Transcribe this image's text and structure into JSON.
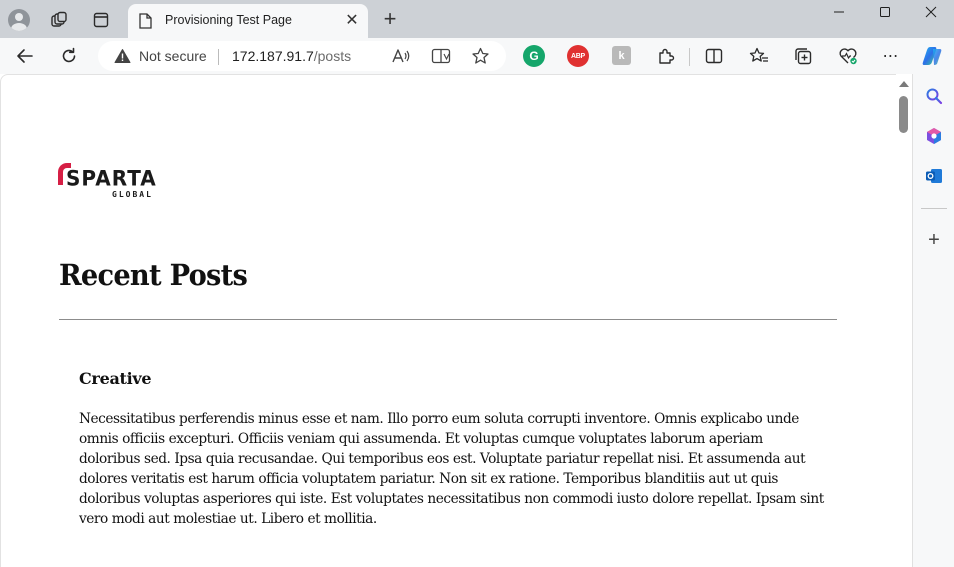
{
  "browser": {
    "tab": {
      "title": "Provisioning Test Page"
    },
    "address": {
      "security_label": "Not secure",
      "url_host": "172.187.91.7",
      "url_path": "/posts"
    },
    "extensions": [
      {
        "name": "grammarly",
        "glyph": "G",
        "color": "#15a66b"
      },
      {
        "name": "adblock-plus",
        "glyph": "ABP",
        "color": "#e03131"
      }
    ]
  },
  "page": {
    "logo": {
      "word": "SPARTA",
      "sub": "GLOBAL",
      "accent_color": "#d61f45"
    },
    "heading": "Recent Posts",
    "posts": [
      {
        "title": "Creative",
        "body": "Necessitatibus perferendis minus esse et nam. Illo porro eum soluta corrupti inventore. Omnis explicabo unde omnis officiis excepturi. Officiis veniam qui assumenda. Et voluptas cumque voluptates laborum aperiam doloribus sed. Ipsa quia recusandae. Qui temporibus eos est. Voluptate pariatur repellat nisi. Et assumenda aut dolores veritatis est harum officia voluptatem pariatur. Non sit ex ratione. Temporibus blanditiis aut ut quis doloribus voluptas asperiores qui iste. Est voluptates necessitatibus non commodi iusto dolore repellat. Ipsam sint vero modi aut molestiae ut. Libero et mollitia."
      }
    ]
  }
}
